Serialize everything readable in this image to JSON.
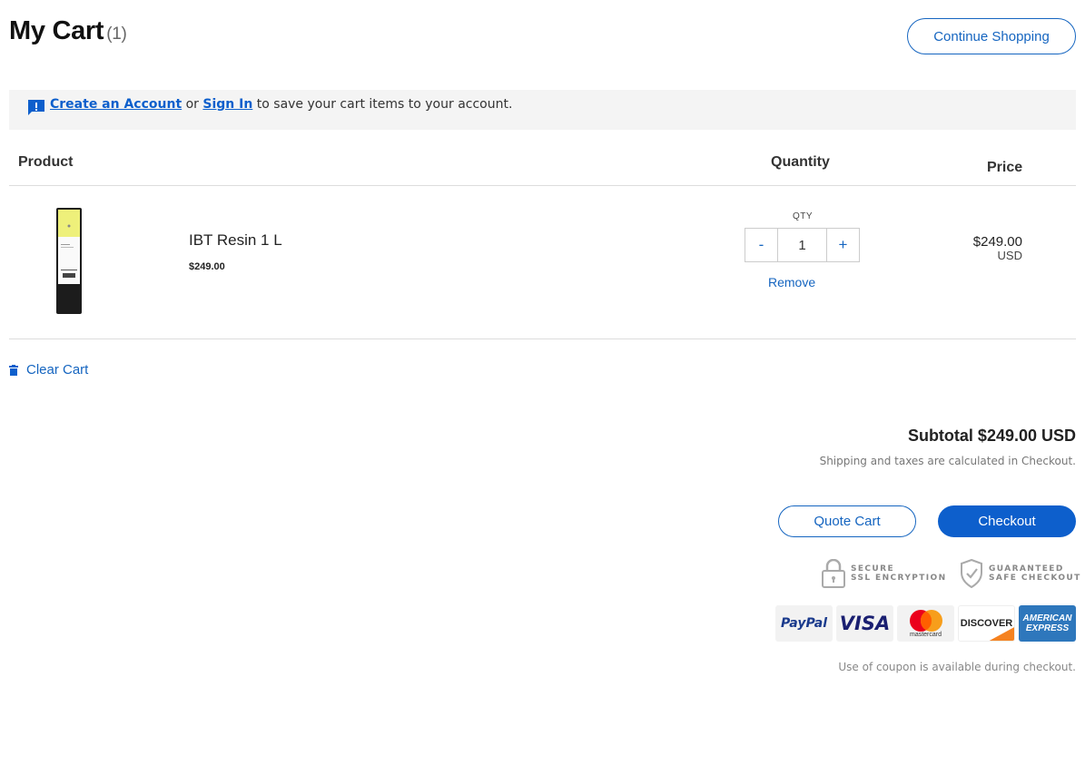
{
  "header": {
    "title": "My Cart",
    "item_count": "(1)",
    "continue_label": "Continue Shopping"
  },
  "account_banner": {
    "create_account": "Create an Account",
    "or": "or",
    "sign_in": "Sign In",
    "suffix": "to save your cart items to your account."
  },
  "table": {
    "headers": {
      "product": "Product",
      "quantity": "Quantity",
      "price": "Price"
    },
    "items": [
      {
        "name": "IBT Resin 1 L",
        "unit_price": "$249.00",
        "qty_label": "QTY",
        "qty_value": "1",
        "minus": "-",
        "plus": "+",
        "remove": "Remove",
        "line_price": "$249.00",
        "currency": "USD"
      }
    ]
  },
  "clear_cart": "Clear Cart",
  "summary": {
    "subtotal": "Subtotal $249.00 USD",
    "shipping_note": "Shipping and taxes are calculated in Checkout.",
    "quote_label": "Quote Cart",
    "checkout_label": "Checkout",
    "ssl_line1": "SECURE",
    "ssl_line2": "SSL ENCRYPTION",
    "guar_line1": "GUARANTEED",
    "guar_line2": "SAFE CHECKOUT",
    "payments": [
      "PayPal",
      "VISA",
      "mastercard",
      "DISCOVER",
      "AMERICAN EXPRESS"
    ],
    "coupon_note": "Use of coupon is available during checkout."
  },
  "colors": {
    "accent": "#0d5fcc",
    "link": "#1565c0",
    "banner_bg": "#f4f4f4"
  }
}
